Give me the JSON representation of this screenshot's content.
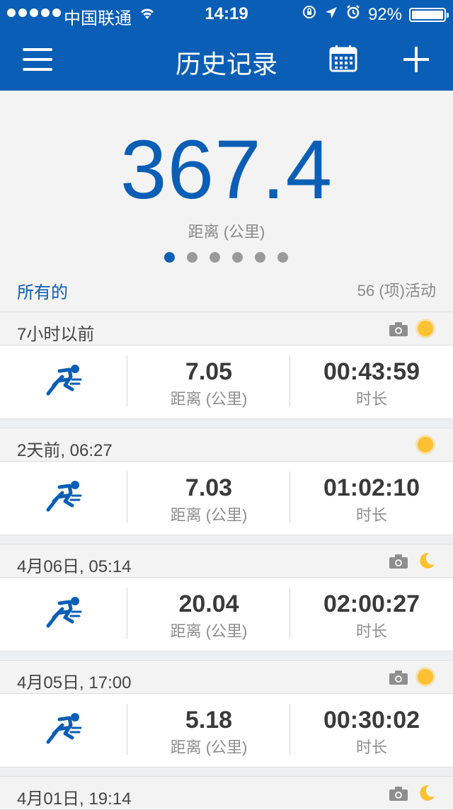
{
  "status_bar": {
    "carrier": "中国联通",
    "time": "14:19",
    "battery": "92%"
  },
  "nav": {
    "title": "历史记录"
  },
  "summary": {
    "value": "367.4",
    "unit": "距离 (公里)",
    "pager_total": 6,
    "pager_active": 1,
    "filter": "所有的",
    "activity_count": "56 (项)活动"
  },
  "entries": [
    {
      "date": "7小时以前",
      "distance": "7.05",
      "distance_label": "距离 (公里)",
      "duration": "00:43:59",
      "duration_label": "时长",
      "has_photo": true,
      "weather": "sun"
    },
    {
      "date": "2天前, 06:27",
      "distance": "7.03",
      "distance_label": "距离 (公里)",
      "duration": "01:02:10",
      "duration_label": "时长",
      "has_photo": false,
      "weather": "sun"
    },
    {
      "date": "4月06日, 05:14",
      "distance": "20.04",
      "distance_label": "距离 (公里)",
      "duration": "02:00:27",
      "duration_label": "时长",
      "has_photo": true,
      "weather": "moon"
    },
    {
      "date": "4月05日, 17:00",
      "distance": "5.18",
      "distance_label": "距离 (公里)",
      "duration": "00:30:02",
      "duration_label": "时长",
      "has_photo": true,
      "weather": "sun"
    },
    {
      "date": "4月01日, 19:14",
      "has_photo": true,
      "weather": "moon"
    }
  ],
  "colors": {
    "primary": "#0a5eb5",
    "sun": "#fdc131",
    "background": "#eeeff1"
  }
}
